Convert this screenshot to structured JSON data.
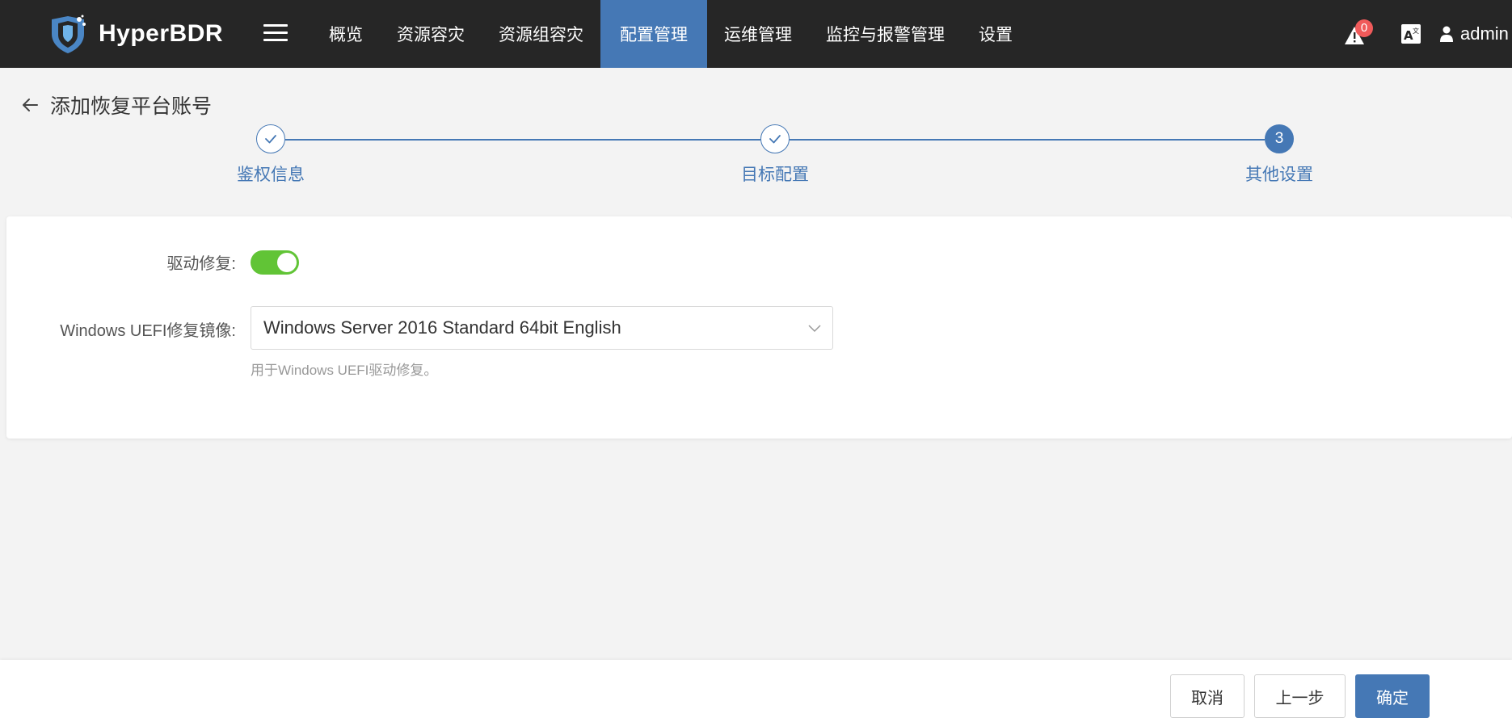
{
  "app": {
    "name": "HyperBDR"
  },
  "nav": {
    "items": [
      {
        "label": "概览"
      },
      {
        "label": "资源容灾"
      },
      {
        "label": "资源组容灾"
      },
      {
        "label": "配置管理",
        "active": true
      },
      {
        "label": "运维管理"
      },
      {
        "label": "监控与报警管理"
      },
      {
        "label": "设置"
      }
    ]
  },
  "header_right": {
    "alert_count": "0",
    "user": "admin"
  },
  "page": {
    "title": "添加恢复平台账号"
  },
  "steps": [
    {
      "label": "鉴权信息",
      "status": "done"
    },
    {
      "label": "目标配置",
      "status": "done"
    },
    {
      "label": "其他设置",
      "status": "current",
      "number": "3"
    }
  ],
  "form": {
    "driver_repair": {
      "label": "驱动修复:",
      "enabled": true
    },
    "uefi_image": {
      "label": "Windows UEFI修复镜像:",
      "value": "Windows Server 2016 Standard 64bit English",
      "hint": "用于Windows UEFI驱动修复。"
    }
  },
  "footer": {
    "cancel": "取消",
    "prev": "上一步",
    "confirm": "确定"
  },
  "colors": {
    "topbar": "#262626",
    "accent": "#4578b5",
    "toggle_on": "#61c436",
    "badge": "#f05a5a"
  }
}
